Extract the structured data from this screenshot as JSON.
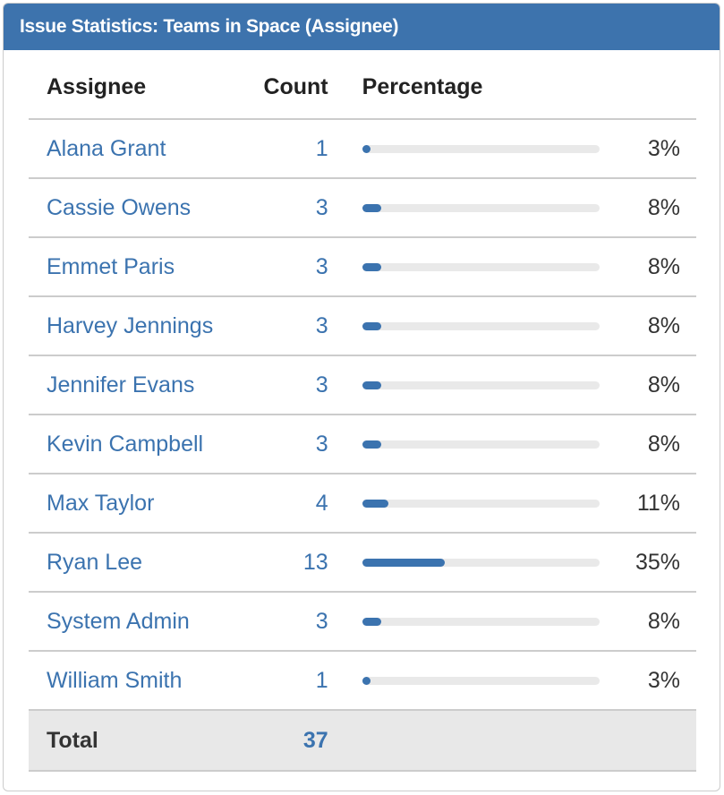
{
  "gadget": {
    "title": "Issue Statistics: Teams in Space (Assignee)"
  },
  "table": {
    "headers": {
      "name": "Assignee",
      "count": "Count",
      "percentage": "Percentage"
    },
    "rows": [
      {
        "name": "Alana Grant",
        "count": "1",
        "percent": 3,
        "percent_label": "3%"
      },
      {
        "name": "Cassie Owens",
        "count": "3",
        "percent": 8,
        "percent_label": "8%"
      },
      {
        "name": "Emmet Paris",
        "count": "3",
        "percent": 8,
        "percent_label": "8%"
      },
      {
        "name": "Harvey Jennings",
        "count": "3",
        "percent": 8,
        "percent_label": "8%"
      },
      {
        "name": "Jennifer Evans",
        "count": "3",
        "percent": 8,
        "percent_label": "8%"
      },
      {
        "name": "Kevin Campbell",
        "count": "3",
        "percent": 8,
        "percent_label": "8%"
      },
      {
        "name": "Max Taylor",
        "count": "4",
        "percent": 11,
        "percent_label": "11%"
      },
      {
        "name": "Ryan Lee",
        "count": "13",
        "percent": 35,
        "percent_label": "35%"
      },
      {
        "name": "System Admin",
        "count": "3",
        "percent": 8,
        "percent_label": "8%"
      },
      {
        "name": "William Smith",
        "count": "1",
        "percent": 3,
        "percent_label": "3%"
      }
    ],
    "total": {
      "label": "Total",
      "count": "37"
    }
  },
  "colors": {
    "header_bg": "#3d73ad",
    "link": "#3b73af",
    "bar_fill": "#3b73af",
    "bar_track": "#e9e9e9",
    "total_bg": "#e8e8e8"
  }
}
